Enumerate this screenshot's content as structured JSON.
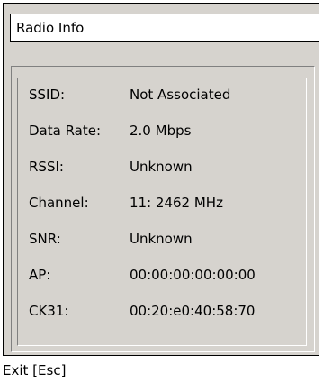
{
  "window": {
    "title": "Radio Info"
  },
  "fields": [
    {
      "label": "SSID:",
      "value": "Not Associated"
    },
    {
      "label": "Data Rate:",
      "value": "2.0 Mbps"
    },
    {
      "label": "RSSI:",
      "value": "Unknown"
    },
    {
      "label": "Channel:",
      "value": "11: 2462 MHz"
    },
    {
      "label": "SNR:",
      "value": "Unknown"
    },
    {
      "label": "AP:",
      "value": "00:00:00:00:00:00"
    },
    {
      "label": "CK31:",
      "value": "00:20:e0:40:58:70"
    }
  ],
  "footer": {
    "exit_label": "Exit [Esc]"
  }
}
